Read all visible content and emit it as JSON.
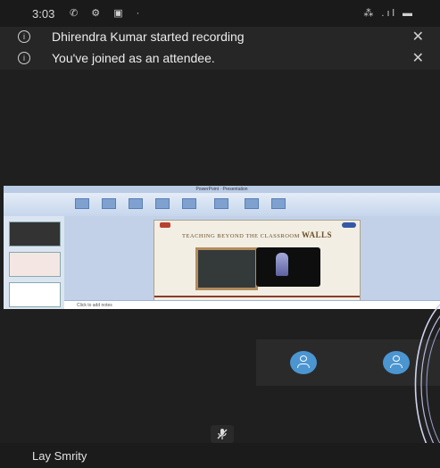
{
  "status_bar": {
    "time": "3:03",
    "left_icons": "✆ ⚙ ▣ ·",
    "right_icons": "⁂ .ıl ▬"
  },
  "notifications": [
    {
      "text": "Dhirendra Kumar started recording",
      "icon": "info-icon",
      "close": "✕"
    },
    {
      "text": "You've joined as an attendee.",
      "icon": "info-icon",
      "close": "✕"
    }
  ],
  "shared_screen": {
    "app_title": "PowerPoint · Presentation",
    "slide_title_small": "TEACHING BEYOND THE CLASSROOM",
    "slide_title_big": "WALLS",
    "notes": "Click to add notes"
  },
  "participants": [
    {
      "icon": "person-icon",
      "color": "#4b95d1"
    },
    {
      "icon": "person-icon",
      "color": "#4b95d1"
    }
  ],
  "mute_indicator": "mic-off-icon",
  "current_user": "Lay Smrity"
}
